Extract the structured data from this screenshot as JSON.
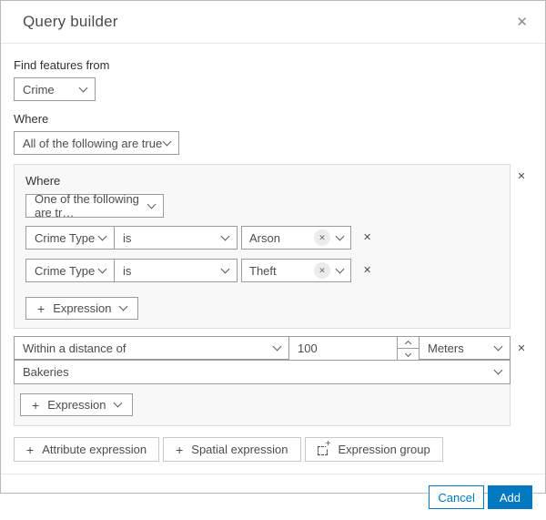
{
  "dialog": {
    "title": "Query builder"
  },
  "icons": {
    "close": "✕",
    "remove": "✕",
    "chip_remove": "✕",
    "plus": "+"
  },
  "source": {
    "label": "Find features from",
    "value": "Crime"
  },
  "where": {
    "label": "Where",
    "operator_value": "All of the following are true"
  },
  "group1": {
    "label": "Where",
    "operator_value": "One of the following are tr…",
    "rows": [
      {
        "field": "Crime Type",
        "operator": "is",
        "value": "Arson"
      },
      {
        "field": "Crime Type",
        "operator": "is",
        "value": "Theft"
      }
    ],
    "add_expression_label": "Expression"
  },
  "group2": {
    "operator_value": "Within a distance of",
    "distance_value": "100",
    "unit_value": "Meters",
    "layer_value": "Bakeries",
    "add_expression_label": "Expression"
  },
  "actions": {
    "attribute_expression": "Attribute expression",
    "spatial_expression": "Spatial expression",
    "expression_group": "Expression group"
  },
  "footer": {
    "cancel": "Cancel",
    "add": "Add"
  },
  "colors": {
    "accent": "#0079c1",
    "input_border": "#9b9b9b",
    "panel_bg": "#f8f8f8",
    "panel_border": "#dddddd",
    "text": "#4c4c4c"
  }
}
